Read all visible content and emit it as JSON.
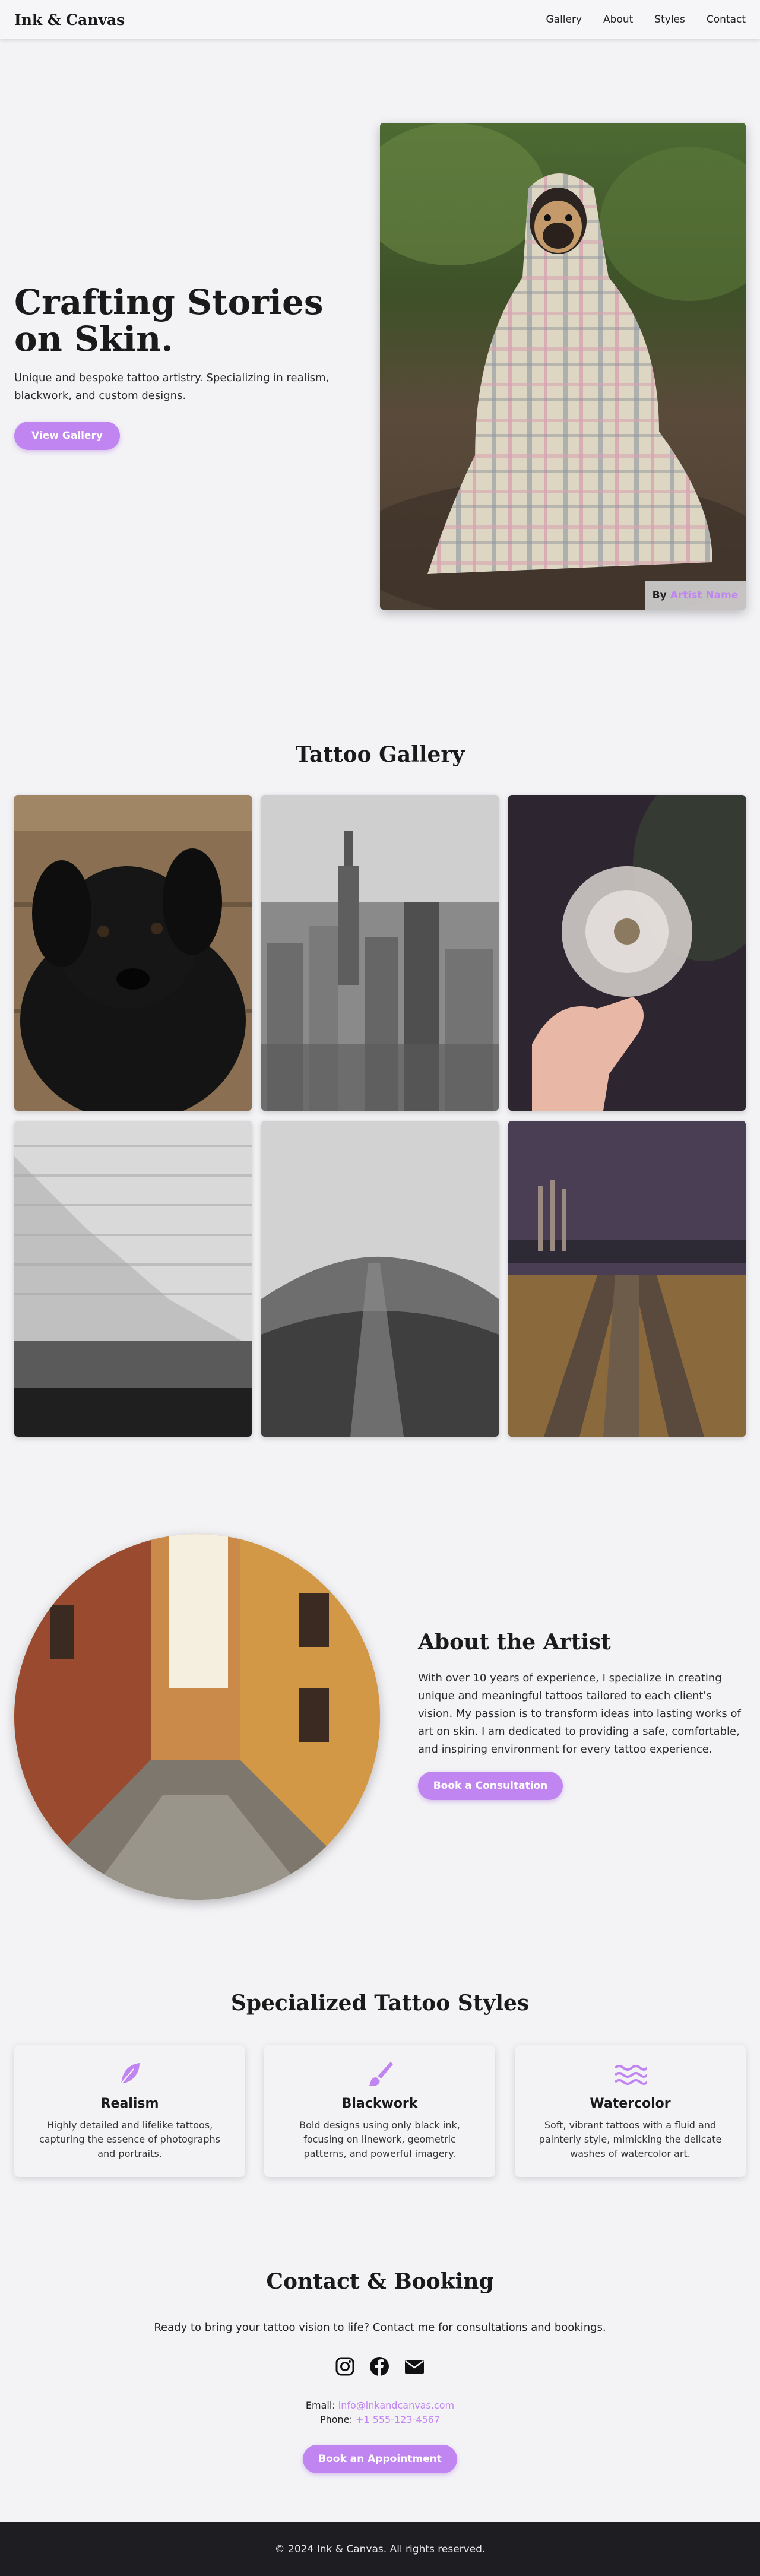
{
  "nav": {
    "brand": "Ink & Canvas",
    "links": [
      "Gallery",
      "About",
      "Styles",
      "Contact"
    ]
  },
  "hero": {
    "title": "Crafting Stories on Skin.",
    "subtitle": "Unique and bespoke tattoo artistry. Specializing in realism, blackwork, and custom designs.",
    "button": "View Gallery",
    "credit_by": "By",
    "credit_name": "Artist Name"
  },
  "gallery": {
    "title": "Tattoo Gallery"
  },
  "about": {
    "title": "About the Artist",
    "text": "With over 10 years of experience, I specialize in creating unique and meaningful tattoos tailored to each client's vision. My passion is to transform ideas into lasting works of art on skin. I am dedicated to providing a safe, comfortable, and inspiring environment for every tattoo experience.",
    "button": "Book a Consultation"
  },
  "styles": {
    "title": "Specialized Tattoo Styles",
    "cards": [
      {
        "title": "Realism",
        "text": "Highly detailed and lifelike tattoos, capturing the essence of photographs and portraits.",
        "icon": "feather-icon"
      },
      {
        "title": "Blackwork",
        "text": "Bold designs using only black ink, focusing on linework, geometric patterns, and powerful imagery.",
        "icon": "brush-icon"
      },
      {
        "title": "Watercolor",
        "text": "Soft, vibrant tattoos with a fluid and painterly style, mimicking the delicate washes of watercolor art.",
        "icon": "water-icon"
      }
    ]
  },
  "contact": {
    "title": "Contact & Booking",
    "text": "Ready to bring your tattoo vision to life? Contact me for consultations and bookings.",
    "email_label": "Email:",
    "email": "info@inkandcanvas.com",
    "phone_label": "Phone:",
    "phone": "+1 555-123-4567",
    "button": "Book an Appointment"
  },
  "footer": {
    "text": "© 2024 Ink & Canvas. All rights reserved."
  },
  "colors": {
    "accent": "#c185f2",
    "footer_bg": "#1e1e22",
    "page_bg": "#f3f3f6"
  }
}
